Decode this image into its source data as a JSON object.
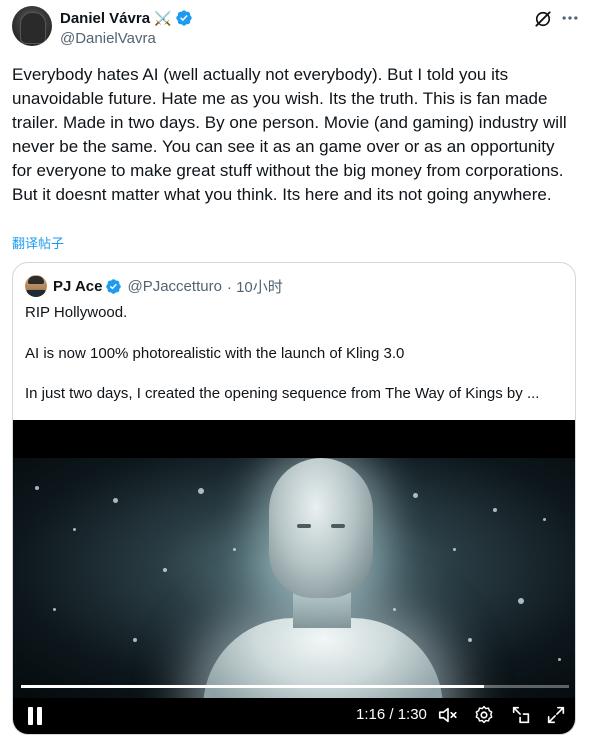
{
  "author": {
    "name": "Daniel Vávra",
    "emoji": "⚔️",
    "handle": "@DanielVavra"
  },
  "tweet": {
    "text": "Everybody hates AI (well actually not everybody). But I told you its unavoidable future. Hate me as you wish. Its the truth. This is fan made trailer. Made in two days. By one person. Movie (and gaming) industry will never be the same. You can see it as an game over or as an opportunity for everyone to make great stuff without the big money from corporations. But it doesnt matter what you think. Its here and its not going anywhere.",
    "translate_label": "翻译帖子"
  },
  "quote": {
    "name": "PJ Ace",
    "handle": "@PJaccetturo",
    "time": "· 10小时",
    "line1": "RIP Hollywood.",
    "line2": "AI is now 100% photorealistic with the launch of Kling 3.0",
    "line3": "In just two days, I created the opening sequence from The Way of Kings by ..."
  },
  "video": {
    "time": "1:16 / 1:30",
    "progress": 0.844
  },
  "icons": {
    "grok": "grok-icon",
    "more": "more-icon",
    "verified": "verified-badge-icon",
    "pause": "pause-icon",
    "mute": "mute-icon",
    "settings": "settings-gear-icon",
    "minimize": "minimize-player-icon",
    "fullscreen": "fullscreen-icon"
  },
  "colors": {
    "accent": "#1d9bf0",
    "text": "#0f1419",
    "secondary": "#536471",
    "border": "#cfd9de"
  }
}
